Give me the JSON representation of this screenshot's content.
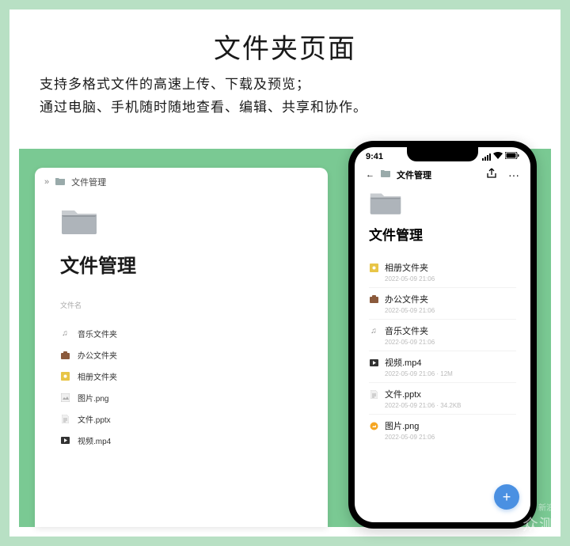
{
  "header": {
    "title": "文件夹页面",
    "subtitle_line1": "支持多格式文件的高速上传、下载及预览；",
    "subtitle_line2": "通过电脑、手机随时随地查看、编辑、共享和协作。"
  },
  "desktop": {
    "breadcrumb_icon": "»",
    "breadcrumb_label": "文件管理",
    "page_title": "文件管理",
    "column_header": "文件名",
    "rows": [
      {
        "icon": "music",
        "name": "音乐文件夹"
      },
      {
        "icon": "briefcase",
        "name": "办公文件夹"
      },
      {
        "icon": "album",
        "name": "相册文件夹"
      },
      {
        "icon": "image",
        "name": "图片.png"
      },
      {
        "icon": "doc",
        "name": "文件.pptx"
      },
      {
        "icon": "video",
        "name": "视频.mp4"
      }
    ]
  },
  "phone": {
    "time": "9:41",
    "back_label": "文件管理",
    "page_title": "文件管理",
    "rows": [
      {
        "icon": "album",
        "name": "相册文件夹",
        "meta": "2022-05-09 21:06"
      },
      {
        "icon": "briefcase",
        "name": "办公文件夹",
        "meta": "2022-05-09 21:06"
      },
      {
        "icon": "music",
        "name": "音乐文件夹",
        "meta": "2022-05-09 21:06"
      },
      {
        "icon": "video",
        "name": "视频.mp4",
        "meta": "2022-05-09 21:06 · 12M"
      },
      {
        "icon": "doc",
        "name": "文件.pptx",
        "meta": "2022-05-09 21:06 · 34.2KB"
      },
      {
        "icon": "image",
        "name": "图片.png",
        "meta": "2022-05-09 21:06"
      }
    ]
  },
  "watermark": {
    "main": "众测",
    "sub": "新浪"
  },
  "icons": {
    "music": "♫",
    "briefcase": "💼",
    "album": "🟨",
    "image": "🖼",
    "doc": "📄",
    "video": "▶",
    "image_orange": "🟠"
  }
}
